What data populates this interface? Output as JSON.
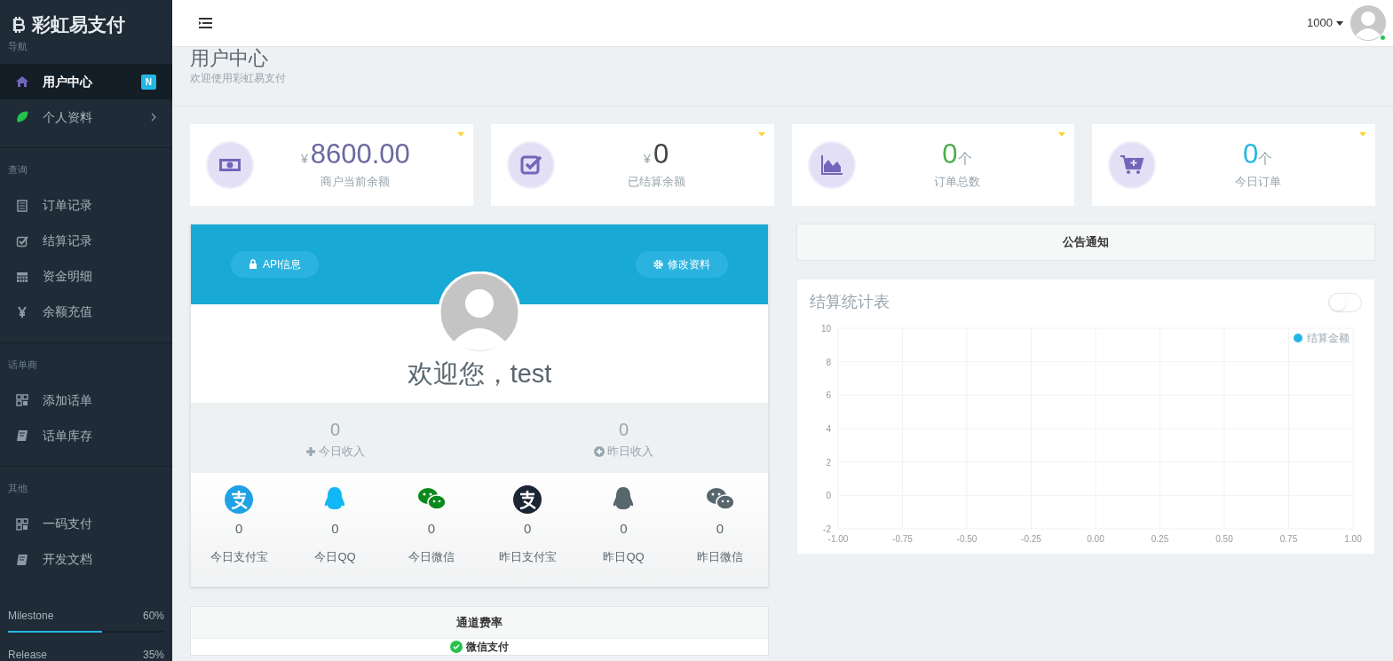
{
  "sidebar": {
    "logo": "彩虹易支付",
    "sections": [
      {
        "title": "导航",
        "items": [
          {
            "label": "用户中心",
            "selected": true,
            "badge": "N",
            "submenu": false
          },
          {
            "label": "个人资料",
            "selected": false,
            "submenu": true
          }
        ]
      },
      {
        "title": "查询",
        "items": [
          {
            "label": "订单记录",
            "selected": false,
            "submenu": false
          },
          {
            "label": "结算记录",
            "selected": false,
            "submenu": false
          },
          {
            "label": "资金明细",
            "selected": false,
            "submenu": false
          },
          {
            "label": "余额充值",
            "selected": false,
            "submenu": false
          }
        ]
      },
      {
        "title": "话单商",
        "items": [
          {
            "label": "添加话单",
            "selected": false,
            "submenu": false
          },
          {
            "label": "话单库存",
            "selected": false,
            "submenu": false
          }
        ]
      },
      {
        "title": "其他",
        "items": [
          {
            "label": "一码支付",
            "selected": false,
            "submenu": false
          },
          {
            "label": "开发文档",
            "selected": false,
            "submenu": false
          }
        ]
      }
    ],
    "progress": [
      {
        "label": "Milestone",
        "reading": "60%",
        "level": 0.6
      },
      {
        "label": "Release",
        "reading": "35%"
      }
    ]
  },
  "header": {
    "user": "1000",
    "online": true
  },
  "page": {
    "title": "用户中心",
    "subtitle": "欢迎使用彩虹易支付"
  },
  "stat_cards": [
    {
      "currency": "¥",
      "value": "8600.00",
      "label": "商户当前余额",
      "color": "#6b689f"
    },
    {
      "currency": "¥",
      "value": "0",
      "label": "已结算余额",
      "color": "#444444"
    },
    {
      "value": "0",
      "unit": "个",
      "label": "订单总数",
      "color": "#4cae4c"
    },
    {
      "value": "0",
      "unit": "个",
      "label": "今日订单",
      "color": "#23b7e5"
    }
  ],
  "profile": {
    "buttons": [
      "API信息",
      "修改资料"
    ],
    "greeting": "欢迎您，",
    "username": "test",
    "income": [
      {
        "value": "0",
        "label": "今日收入"
      },
      {
        "value": "0",
        "label": "昨日收入"
      }
    ],
    "payments": [
      {
        "value": "0",
        "label": "今日支付宝"
      },
      {
        "value": "0",
        "label": "今日QQ"
      },
      {
        "value": "0",
        "label": "今日微信"
      },
      {
        "value": "0",
        "label": "昨日支付宝"
      },
      {
        "value": "0",
        "label": "昨日QQ"
      },
      {
        "value": "0",
        "label": "昨日微信"
      }
    ]
  },
  "channel_rates": {
    "title": "通道费率",
    "rows": [
      "微信支付"
    ]
  },
  "notice": {
    "title": "公告通知"
  },
  "chart_panel": {
    "title": "结算统计表",
    "toggle_on": false,
    "chart_data": {
      "type": "line",
      "series": [
        {
          "name": "结算金额",
          "color": "#23b7e5",
          "values": [
            null,
            null,
            null,
            null,
            null,
            null,
            null,
            null,
            null
          ]
        }
      ],
      "categories": [
        "-1.00",
        "-0.75",
        "-0.50",
        "-0.25",
        "0.00",
        "0.25",
        "0.50",
        "0.75",
        "1.00"
      ],
      "ylim": [
        -2,
        10
      ],
      "yticks": [
        -2,
        0,
        2,
        4,
        6,
        8,
        10
      ],
      "grid": true
    }
  }
}
